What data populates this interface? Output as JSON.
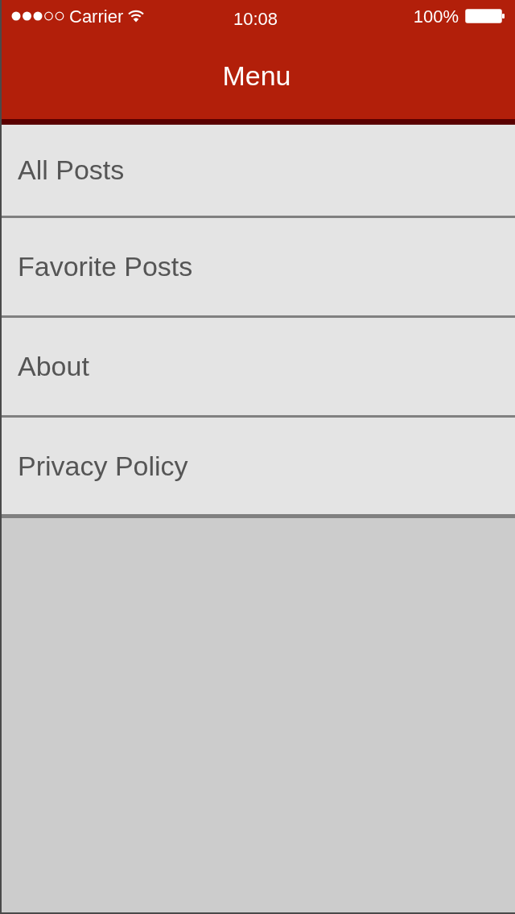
{
  "status_bar": {
    "carrier": "Carrier",
    "time": "10:08",
    "battery": "100%"
  },
  "nav_bar": {
    "title": "Menu"
  },
  "menu": {
    "items": [
      {
        "label": "All Posts"
      },
      {
        "label": "Favorite Posts"
      },
      {
        "label": "About"
      },
      {
        "label": "Privacy Policy"
      }
    ]
  }
}
